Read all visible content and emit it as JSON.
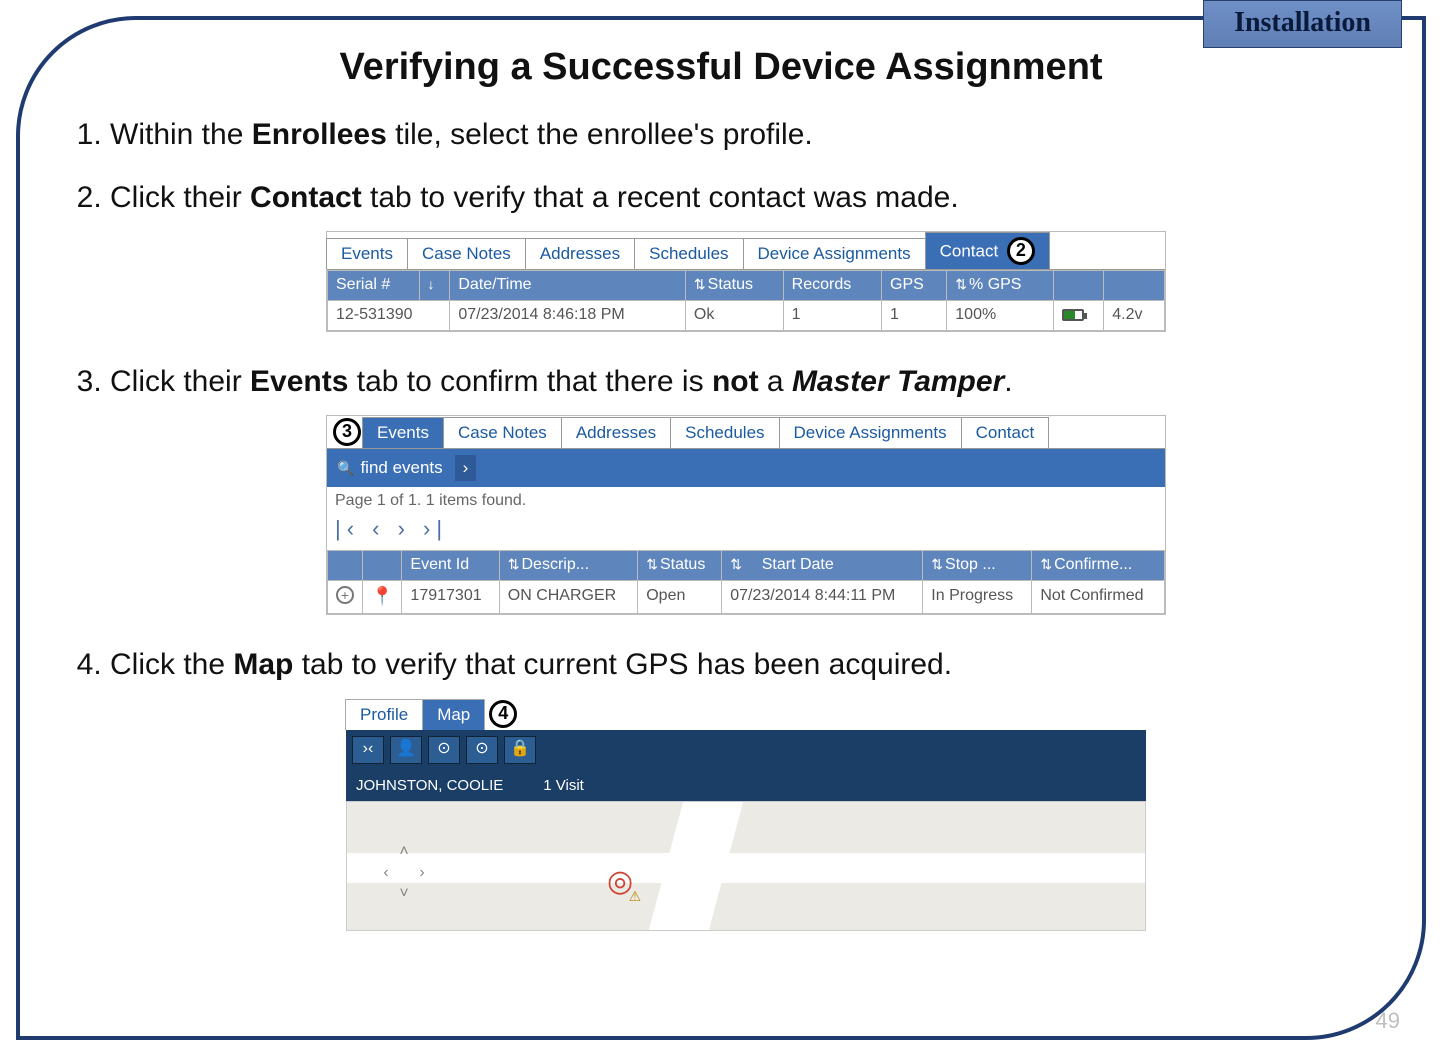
{
  "badge": "Installation",
  "title": "Verifying a Successful Device Assignment",
  "page_number": "49",
  "steps": {
    "s1_pre": "Within the ",
    "s1_b": "Enrollees",
    "s1_post": " tile, select the enrollee's profile.",
    "s2_pre": "Click their ",
    "s2_b": "Contact",
    "s2_post": " tab to verify that a recent contact was made.",
    "s3_pre": "Click their ",
    "s3_b": "Events",
    "s3_mid": " tab to confirm that there is ",
    "s3_b2": "not",
    "s3_mid2": " a ",
    "s3_bi": "Master Tamper",
    "s3_post": ".",
    "s4_pre": "Click the ",
    "s4_b": "Map",
    "s4_post": " tab to verify that current GPS has been acquired."
  },
  "callouts": {
    "c2": "2",
    "c3": "3",
    "c4": "4"
  },
  "shot1": {
    "tabs": [
      "Events",
      "Case Notes",
      "Addresses",
      "Schedules",
      "Device Assignments",
      "Contact"
    ],
    "headers": [
      "Serial #",
      "Date/Time",
      "Status",
      "Records",
      "GPS",
      "% GPS"
    ],
    "row": {
      "serial": "12-531390",
      "datetime": "07/23/2014 8:46:18 PM",
      "status": "Ok",
      "records": "1",
      "gps": "1",
      "pct": "100%",
      "volt": "4.2v"
    }
  },
  "shot2": {
    "tabs": [
      "Events",
      "Case Notes",
      "Addresses",
      "Schedules",
      "Device Assignments",
      "Contact"
    ],
    "search": "find events",
    "pager_text": "Page 1 of 1. 1 items found.",
    "headers": [
      "Event Id",
      "Descrip...",
      "Status",
      "Start Date",
      "Stop ...",
      "Confirme..."
    ],
    "row": {
      "id": "17917301",
      "desc": "ON CHARGER",
      "status": "Open",
      "start": "07/23/2014 8:44:11 PM",
      "stop": "In Progress",
      "conf": "Not Confirmed"
    }
  },
  "shot3": {
    "tabs": [
      "Profile",
      "Map"
    ],
    "name": "JOHNSTON, COOLIE",
    "visits": "1 Visit"
  }
}
